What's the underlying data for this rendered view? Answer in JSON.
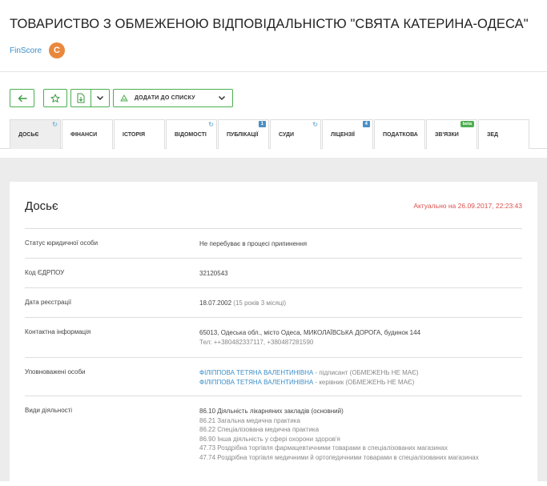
{
  "company": {
    "title": "ТОВАРИСТВО З ОБМЕЖЕНОЮ ВІДПОВІДАЛЬНІСТЮ \"СВЯТА КАТЕРИНА-ОДЕСА\"",
    "finscore_label": "FinScore",
    "finscore_grade": "C"
  },
  "toolbar": {
    "add_to_list": "ДОДАТИ ДО СПИСКУ"
  },
  "tabs": [
    {
      "label": "ДОСЬЄ",
      "badge": "refresh"
    },
    {
      "label": "ФІНАНСИ",
      "badge": ""
    },
    {
      "label": "ІСТОРІЯ",
      "badge": ""
    },
    {
      "label": "ВІДОМОСТІ",
      "badge": "refresh"
    },
    {
      "label": "ПУБЛІКАЦІЇ",
      "badge": "1"
    },
    {
      "label": "СУДИ",
      "badge": "refresh"
    },
    {
      "label": "ЛІЦЕНЗІЇ",
      "badge": "4"
    },
    {
      "label": "ПОДАТКОВА",
      "badge": ""
    },
    {
      "label": "ЗВ'ЯЗКИ",
      "badge": "beta"
    },
    {
      "label": "ЗЕД",
      "badge": ""
    }
  ],
  "dossier": {
    "title": "Досьє",
    "actual": "Актуально на 26.09.2017, 22:23:43",
    "status_label": "Статус юридичної особи",
    "status_value": "Не перебуває в процесі припинення",
    "edrpou_label": "Код ЄДРПОУ",
    "edrpou_value": "32120543",
    "reg_label": "Дата реєстрації",
    "reg_date": "18.07.2002",
    "reg_age": "(15 років 3 місяці)",
    "contact_label": "Контактна інформація",
    "contact_address": "65013, Одеська обл., місто Одеса, МИКОЛАЇВСЬКА ДОРОГА, будинок 144",
    "contact_phone": "Тел: ++380482337117, +380487281590",
    "auth_label": "Уповноважені особи",
    "persons": [
      {
        "name": "ФІЛІППОВА ТЕТЯНА ВАЛЕНТИНІВНА",
        "role": " - підписант (ОБМЕЖЕНЬ НЕ МАЄ)"
      },
      {
        "name": "ФІЛІППОВА ТЕТЯНА ВАЛЕНТИНІВНА",
        "role": " - керівник (ОБМЕЖЕНЬ НЕ МАЄ)"
      }
    ],
    "activities_label": "Види діяльності",
    "activity_main": "86.10 Діяльність лікарняних закладів (основний)",
    "activities": [
      "86.21 Загальна медична практика",
      "86.22 Спеціалізована медична практика",
      "86.90 Інша діяльність у сфері охорони здоров'я",
      "47.73 Роздрібна торгівля фармацевтичними товарами в спеціалізованих магазинах",
      "47.74 Роздрібна торгівля медичними й ортопедичними товарами в спеціалізованих магазинах"
    ]
  }
}
